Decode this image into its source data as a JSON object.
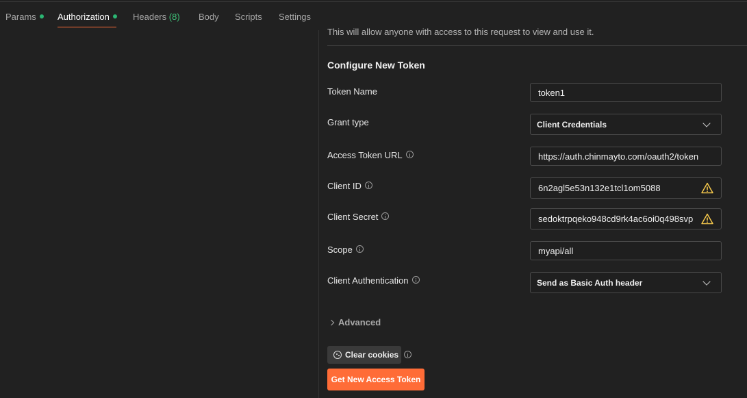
{
  "tabs": [
    {
      "label": "Params",
      "dot": true
    },
    {
      "label": "Authorization",
      "dot": true
    },
    {
      "label": "Headers",
      "count": "(8)"
    },
    {
      "label": "Body"
    },
    {
      "label": "Scripts"
    },
    {
      "label": "Settings"
    }
  ],
  "info_text": "This will allow anyone with access to this request to view and use it.",
  "section_title": "Configure New Token",
  "fields": {
    "token_name": {
      "label": "Token Name",
      "value": "token1"
    },
    "grant_type": {
      "label": "Grant type",
      "value": "Client Credentials"
    },
    "access_token_url": {
      "label": "Access Token URL",
      "value": "https://auth.chinmayto.com/oauth2/token"
    },
    "client_id": {
      "label": "Client ID",
      "value": "6n2agl5e53n132e1tcl1om5088"
    },
    "client_secret": {
      "label": "Client Secret",
      "value": "sedoktrpqeko948cd9rk4ac6oi0q498svp"
    },
    "scope": {
      "label": "Scope",
      "value": "myapi/all"
    },
    "client_auth": {
      "label": "Client Authentication",
      "value": "Send as Basic Auth header"
    }
  },
  "advanced_label": "Advanced",
  "clear_cookies_label": "Clear cookies",
  "get_token_label": "Get New Access Token",
  "colors": {
    "accent": "#ff6c37",
    "dot": "#2bb673",
    "warning": "#f5c84c"
  }
}
